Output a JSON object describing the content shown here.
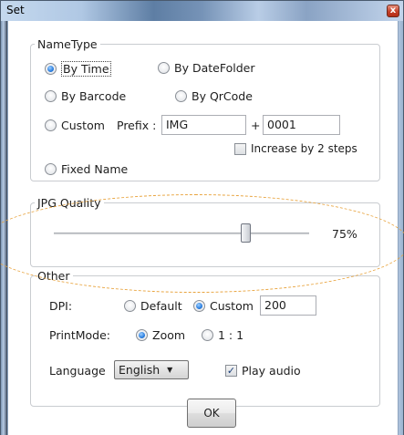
{
  "window": {
    "title": "Set",
    "close_symbol": "x"
  },
  "name_type": {
    "legend": "NameType",
    "options": {
      "by_time": "By Time",
      "by_date_folder": "By DateFolder",
      "by_barcode": "By Barcode",
      "by_qrcode": "By QrCode",
      "custom": "Custom",
      "fixed_name": "Fixed Name"
    },
    "selected": "by_time",
    "prefix_label": "Prefix :",
    "prefix_value": "IMG",
    "plus": "+",
    "number_value": "0001",
    "increase_label": "Increase by 2 steps",
    "increase_checked": false
  },
  "jpg_quality": {
    "legend": "JPG Quality",
    "value": 75,
    "value_text": "75%"
  },
  "other": {
    "legend": "Other",
    "dpi_label": "DPI:",
    "dpi_default": "Default",
    "dpi_custom": "Custom",
    "dpi_selected": "custom",
    "dpi_value": "200",
    "printmode_label": "PrintMode:",
    "printmode_zoom": "Zoom",
    "printmode_1to1": "1 : 1",
    "printmode_selected": "zoom",
    "language_label": "Language",
    "language_value": "English",
    "play_audio_label": "Play audio",
    "play_audio_checked": true
  },
  "ok_button": "OK",
  "colors": {
    "accent": "#2a7ee0",
    "title_gradient": "#5e7ea4",
    "close_red": "#c4412a",
    "highlight": "#e8a33d"
  },
  "icons": [
    "close-icon",
    "dropdown-arrow-icon",
    "checkmark-icon"
  ]
}
